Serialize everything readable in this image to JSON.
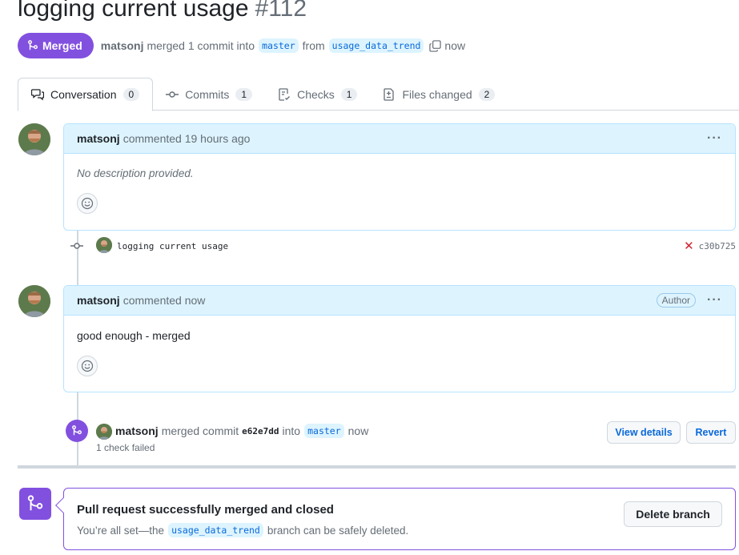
{
  "pr": {
    "title": "logging current usage",
    "number": "#112",
    "state": "Merged",
    "author": "matsonj",
    "merge_text_1": "merged 1 commit into",
    "base_branch": "master",
    "from_text": "from",
    "head_branch": "usage_data_trend",
    "time": "now"
  },
  "tabs": [
    {
      "label": "Conversation",
      "count": "0",
      "icon": "comment-discussion-icon"
    },
    {
      "label": "Commits",
      "count": "1",
      "icon": "git-commit-icon"
    },
    {
      "label": "Checks",
      "count": "1",
      "icon": "checklist-icon"
    },
    {
      "label": "Files changed",
      "count": "2",
      "icon": "file-diff-icon"
    }
  ],
  "comments": [
    {
      "author": "matsonj",
      "meta": "commented 19 hours ago",
      "body": "No description provided.",
      "menu": "···"
    },
    {
      "author": "matsonj",
      "meta": "commented now",
      "badge": "Author",
      "body": "good enough - merged",
      "menu": "···"
    }
  ],
  "commit": {
    "message": "logging current usage",
    "sha": "c30b725",
    "status": "failed"
  },
  "merge_event": {
    "author": "matsonj",
    "text": "merged commit",
    "sha": "e62e7dd",
    "into": "into",
    "branch": "master",
    "time": "now",
    "checks": "1 check failed",
    "view_details": "View details",
    "revert": "Revert"
  },
  "merge_box": {
    "title": "Pull request successfully merged and closed",
    "text_before": "You’re all set—the",
    "branch": "usage_data_trend",
    "text_after": "branch can be safely deleted.",
    "delete_button": "Delete branch"
  },
  "colors": {
    "merged": "#8250df",
    "comment_header": "#ddf4ff",
    "link": "#0969da",
    "danger": "#cf222e"
  }
}
